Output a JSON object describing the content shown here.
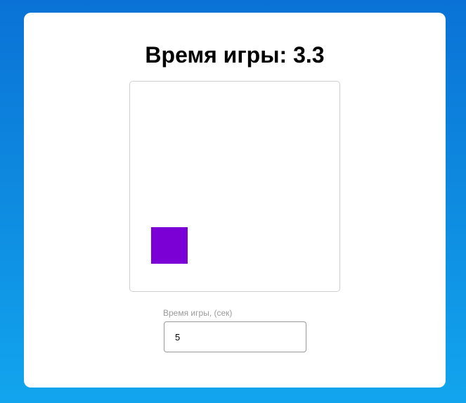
{
  "header": {
    "title": "Время игры: 3.3"
  },
  "game": {
    "target_color": "#7b00d6"
  },
  "settings": {
    "time_label": "Время игры, (сек)",
    "time_value": "5"
  },
  "colors": {
    "background_top": "#0a72d6",
    "background_bottom": "#12a5ee",
    "card": "#ffffff"
  }
}
